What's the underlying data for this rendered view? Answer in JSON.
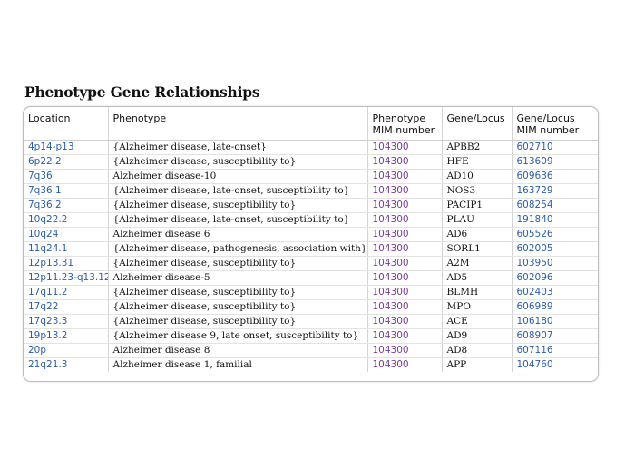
{
  "title": "Phenotype Gene Relationships",
  "colors": {
    "link": "#2c5ea8",
    "visited_link": "#7b3a9a",
    "text": "#111111",
    "border": "#bdbdbd"
  },
  "table": {
    "headers": {
      "location": "Location",
      "phenotype": "Phenotype",
      "phenotype_mim": "Phenotype\nMIM number",
      "gene_locus": "Gene/Locus",
      "gene_locus_mim": "Gene/Locus\nMIM number"
    },
    "rows": [
      {
        "location": "4p14-p13",
        "phenotype": "{Alzheimer disease, late-onset}",
        "phenotype_mim": "104300",
        "gene_locus": "APBB2",
        "gene_locus_mim": "602710"
      },
      {
        "location": "6p22.2",
        "phenotype": "{Alzheimer disease, susceptibility to}",
        "phenotype_mim": "104300",
        "gene_locus": "HFE",
        "gene_locus_mim": "613609"
      },
      {
        "location": "7q36",
        "phenotype": "Alzheimer disease-10",
        "phenotype_mim": "104300",
        "gene_locus": "AD10",
        "gene_locus_mim": "609636"
      },
      {
        "location": "7q36.1",
        "phenotype": "{Alzheimer disease, late-onset, susceptibility to}",
        "phenotype_mim": "104300",
        "gene_locus": "NOS3",
        "gene_locus_mim": "163729"
      },
      {
        "location": "7q36.2",
        "phenotype": "{Alzheimer disease, susceptibility to}",
        "phenotype_mim": "104300",
        "gene_locus": "PACIP1",
        "gene_locus_mim": "608254"
      },
      {
        "location": "10q22.2",
        "phenotype": "{Alzheimer disease, late-onset, susceptibility to}",
        "phenotype_mim": "104300",
        "gene_locus": "PLAU",
        "gene_locus_mim": "191840"
      },
      {
        "location": "10q24",
        "phenotype": "Alzheimer disease 6",
        "phenotype_mim": "104300",
        "gene_locus": "AD6",
        "gene_locus_mim": "605526"
      },
      {
        "location": "11q24.1",
        "phenotype": "{Alzheimer disease, pathogenesis, association with}",
        "phenotype_mim": "104300",
        "gene_locus": "SORL1",
        "gene_locus_mim": "602005"
      },
      {
        "location": "12p13.31",
        "phenotype": "{Alzheimer disease, susceptibility to}",
        "phenotype_mim": "104300",
        "gene_locus": "A2M",
        "gene_locus_mim": "103950"
      },
      {
        "location": "12p11.23-q13.12",
        "phenotype": "Alzheimer disease-5",
        "phenotype_mim": "104300",
        "gene_locus": "AD5",
        "gene_locus_mim": "602096"
      },
      {
        "location": "17q11.2",
        "phenotype": "{Alzheimer disease, susceptibility to}",
        "phenotype_mim": "104300",
        "gene_locus": "BLMH",
        "gene_locus_mim": "602403"
      },
      {
        "location": "17q22",
        "phenotype": "{Alzheimer disease, susceptibility to}",
        "phenotype_mim": "104300",
        "gene_locus": "MPO",
        "gene_locus_mim": "606989"
      },
      {
        "location": "17q23.3",
        "phenotype": "{Alzheimer disease, susceptibility to}",
        "phenotype_mim": "104300",
        "gene_locus": "ACE",
        "gene_locus_mim": "106180"
      },
      {
        "location": "19p13.2",
        "phenotype": "{Alzheimer disease 9, late onset, susceptibility to}",
        "phenotype_mim": "104300",
        "gene_locus": "AD9",
        "gene_locus_mim": "608907"
      },
      {
        "location": "20p",
        "phenotype": "Alzheimer disease 8",
        "phenotype_mim": "104300",
        "gene_locus": "AD8",
        "gene_locus_mim": "607116"
      },
      {
        "location": "21q21.3",
        "phenotype": "Alzheimer disease 1, familial",
        "phenotype_mim": "104300",
        "gene_locus": "APP",
        "gene_locus_mim": "104760"
      }
    ]
  }
}
